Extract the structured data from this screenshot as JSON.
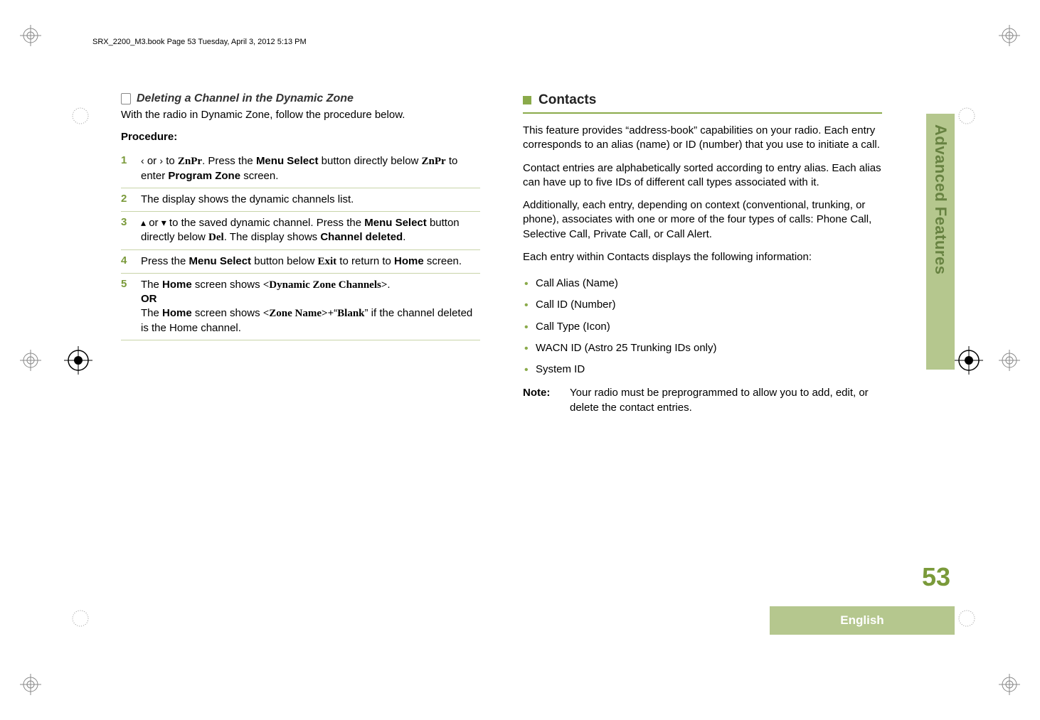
{
  "header": {
    "running": "SRX_2200_M3.book  Page 53  Tuesday, April 3, 2012  5:13 PM"
  },
  "left": {
    "heading": "Deleting a Channel in the Dynamic Zone",
    "intro": "With the radio in Dynamic Zone, follow the procedure below.",
    "procedureLabel": "Procedure:",
    "steps": {
      "s1a": " or ",
      "s1b": " to ",
      "s1c": "ZnPr",
      "s1d": ". Press the ",
      "s1e": "Menu Select",
      "s1f": " button directly below ",
      "s1g": "ZnPr",
      "s1h": " to enter ",
      "s1i": "Program Zone",
      "s1j": " screen.",
      "s2": "The display shows the dynamic channels list.",
      "s3a": " or ",
      "s3b": " to the saved dynamic channel. Press the ",
      "s3c": "Menu Select",
      "s3d": " button directly below ",
      "s3e": "Del",
      "s3f": ". The display shows ",
      "s3g": "Channel deleted",
      "s3h": ".",
      "s4a": "Press the ",
      "s4b": "Menu Select",
      "s4c": " button below ",
      "s4d": "Exit",
      "s4e": " to return to ",
      "s4f": "Home",
      "s4g": " screen.",
      "s5a": "The ",
      "s5b": "Home",
      "s5c": " screen shows ",
      "s5d": "<Dynamic Zone Channels>",
      "s5e": ".",
      "s5or": "OR",
      "s5f": "The ",
      "s5g": "Home",
      "s5h": " screen shows ",
      "s5i": "<Zone Name>+",
      "s5j": "“",
      "s5k": "Blank",
      "s5l": "” if the channel deleted is the Home channel."
    }
  },
  "right": {
    "heading": "Contacts",
    "p1": "This feature provides “address-book” capabilities on your radio. Each entry corresponds to an alias (name) or ID (number) that you use to initiate a call.",
    "p2": "Contact entries are alphabetically sorted according to entry alias. Each alias can have up to five IDs of different call types associated with it.",
    "p3": "Additionally, each entry, depending on context (conventional, trunking, or phone), associates with one or more of the four types of calls: Phone Call, Selective Call, Private Call, or Call Alert.",
    "p4": "Each entry within Contacts displays the following information:",
    "bullets": {
      "b1": "Call Alias (Name)",
      "b2": "Call ID (Number)",
      "b3": "Call Type (Icon)",
      "b4": "WACN ID (Astro 25 Trunking IDs only)",
      "b5": "System ID"
    },
    "noteLabel": "Note:",
    "noteText": "Your radio must be preprogrammed to allow you to add, edit, or delete the contact entries."
  },
  "sideTab": "Advanced Features",
  "pageNumber": "53",
  "footer": "English",
  "glyphs": {
    "left": "‹",
    "right": "›",
    "up": "▴",
    "down": "▾"
  }
}
